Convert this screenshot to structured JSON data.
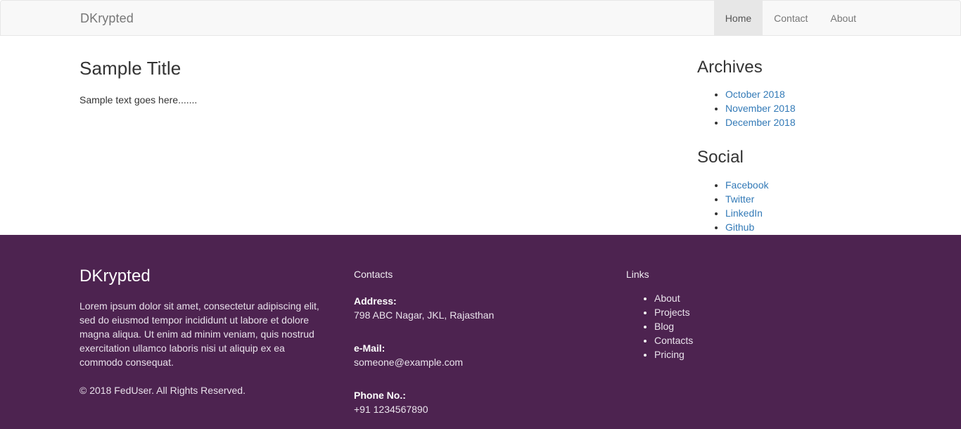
{
  "navbar": {
    "brand": "DKrypted",
    "items": [
      {
        "label": "Home",
        "active": true
      },
      {
        "label": "Contact",
        "active": false
      },
      {
        "label": "About",
        "active": false
      }
    ]
  },
  "main": {
    "title": "Sample Title",
    "text": "Sample text goes here......."
  },
  "sidebar": {
    "archives": {
      "heading": "Archives",
      "items": [
        "October 2018",
        "November 2018",
        "December 2018"
      ]
    },
    "social": {
      "heading": "Social",
      "items": [
        "Facebook",
        "Twitter",
        "LinkedIn",
        "Github"
      ]
    }
  },
  "footer": {
    "brand": "DKrypted",
    "about": "Lorem ipsum dolor sit amet, consectetur adipiscing elit, sed do eiusmod tempor incididunt ut labore et dolore magna aliqua. Ut enim ad minim veniam, quis nostrud exercitation ullamco laboris nisi ut aliquip ex ea commodo consequat.",
    "copyright": "© 2018 FedUser. All Rights Reserved.",
    "contacts": {
      "heading": "Contacts",
      "address_label": "Address:",
      "address_value": "798 ABC Nagar, JKL, Rajasthan",
      "email_label": "e-Mail:",
      "email_value": "someone@example.com",
      "phone_label": "Phone No.:",
      "phone_value": "+91 1234567890"
    },
    "links": {
      "heading": "Links",
      "items": [
        "About",
        "Projects",
        "Blog",
        "Contacts",
        "Pricing"
      ]
    }
  },
  "colors": {
    "navbar_bg": "#f8f8f8",
    "navbar_border": "#e7e7e7",
    "navbar_active_bg": "#e7e7e7",
    "link_blue": "#337ab7",
    "footer_bg": "#4d2350",
    "brand_gray": "#777777"
  }
}
